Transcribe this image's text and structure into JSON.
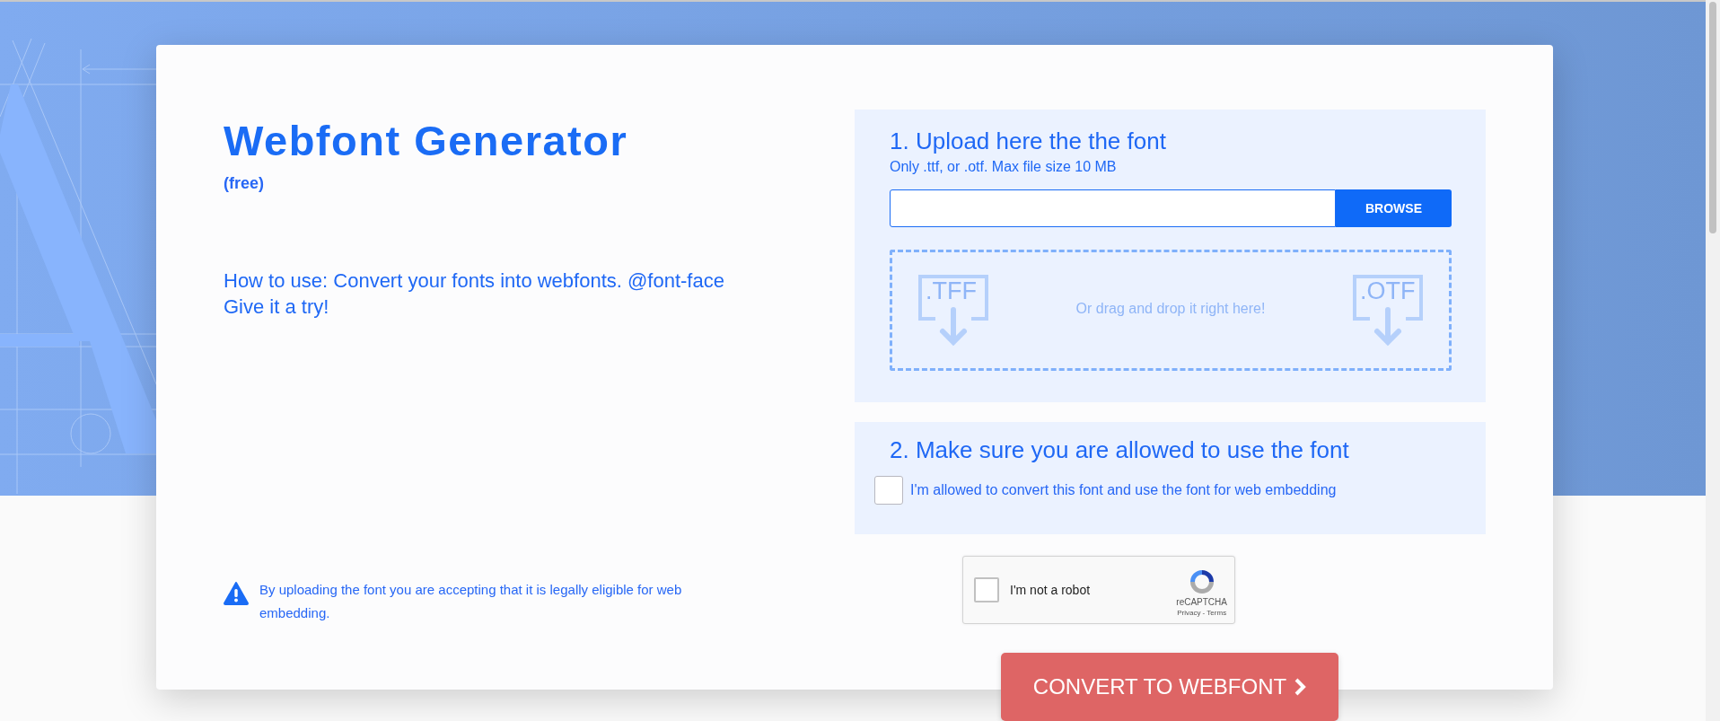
{
  "header": {
    "title": "Webfont Generator",
    "subtitle": "(free)",
    "intro_lines": [
      "How to use: Convert your fonts into webfonts. @font-face",
      "Give it a try!"
    ]
  },
  "notice": "By uploading the font you are accepting that it is legally eligible for web embedding.",
  "upload": {
    "heading": "1. Upload here the the font",
    "hint": "Only .ttf, or .otf. Max file size 10 MB",
    "browse_button": "BROWSE",
    "dropzone": {
      "file_types": [
        ".TFF",
        ".OTF"
      ],
      "text": "Or drag and drop it right here!"
    }
  },
  "permission": {
    "heading": "2. Make sure you are allowed to use the font",
    "checkbox": {
      "label": "I'm allowed to convert this font and use the font for web embedding",
      "checked": false
    }
  },
  "captcha": {
    "label": "I'm not a robot",
    "checked": false,
    "brand": "reCAPTCHA",
    "links": "Privacy - Terms"
  },
  "convert_button": {
    "label": "CONVERT TO WEBFONT"
  }
}
